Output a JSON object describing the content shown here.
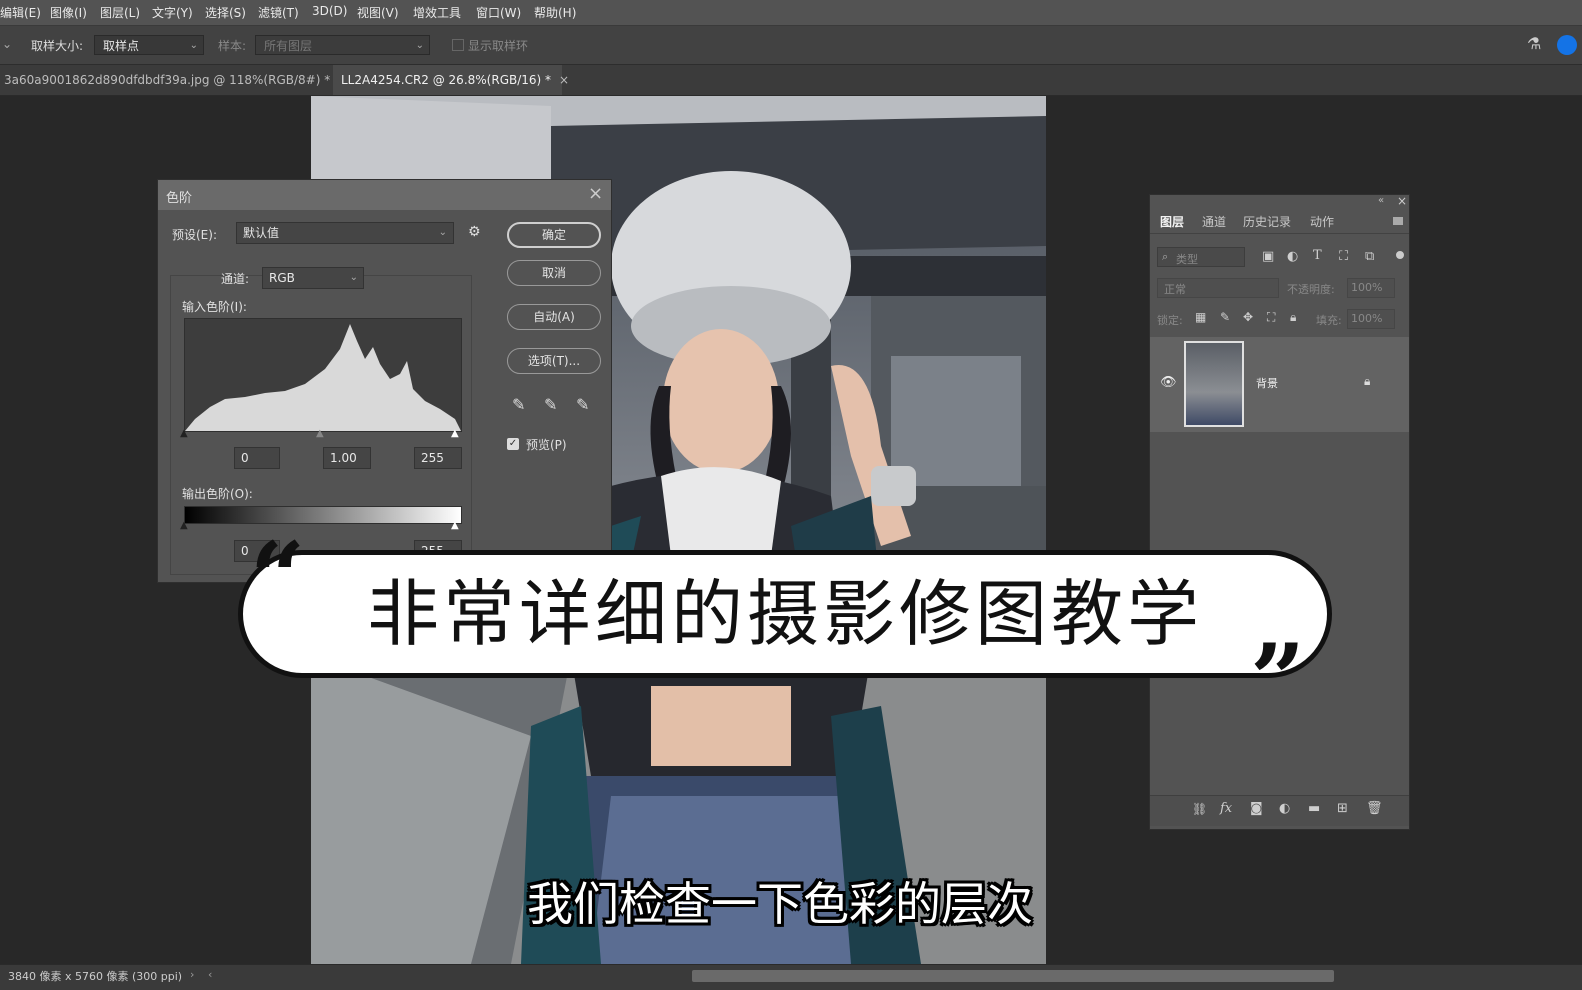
{
  "menu": [
    "编辑(E)",
    "图像(I)",
    "图层(L)",
    "文字(Y)",
    "选择(S)",
    "滤镜(T)",
    "3D(D)",
    "视图(V)",
    "增效工具",
    "窗口(W)",
    "帮助(H)"
  ],
  "options": {
    "sample_size_label": "取样大小:",
    "sample_size_value": "取样点",
    "sample_label": "样本:",
    "sample_value": "所有图层",
    "show_ring_label": "显示取样环"
  },
  "tabs": [
    {
      "label": "3a60a9001862d890dfdbdf39a.jpg @ 118%(RGB/8#) *",
      "close": "×"
    },
    {
      "label": "LL2A4254.CR2 @ 26.8%(RGB/16) *",
      "close": "×"
    }
  ],
  "levels": {
    "title": "色阶",
    "close": "×",
    "preset_label": "预设(E):",
    "preset_value": "默认值",
    "channel_label": "通道:",
    "channel_value": "RGB",
    "input_label": "输入色阶(I):",
    "input_black": "0",
    "input_gamma": "1.00",
    "input_white": "255",
    "output_label": "输出色阶(O):",
    "output_black": "0",
    "output_white": "255",
    "btn_ok": "确定",
    "btn_cancel": "取消",
    "btn_auto": "自动(A)",
    "btn_options": "选项(T)...",
    "preview_label": "预览(P)"
  },
  "layers_panel": {
    "tabs": [
      "图层",
      "通道",
      "历史记录",
      "动作"
    ],
    "filter_placeholder": "类型",
    "blend_mode": "正常",
    "opacity_label": "不透明度:",
    "opacity_value": "100%",
    "lock_label": "锁定:",
    "fill_label": "填充:",
    "fill_value": "100%",
    "layer_name": "背景"
  },
  "overlay": {
    "title": "非常详细的摄影修图教学",
    "open_quote": "“",
    "close_quote": "”",
    "subtitle": "我们检查一下色彩的层次"
  },
  "status": {
    "doc_info": "3840 像素 x 5760 像素 (300 ppi)"
  }
}
